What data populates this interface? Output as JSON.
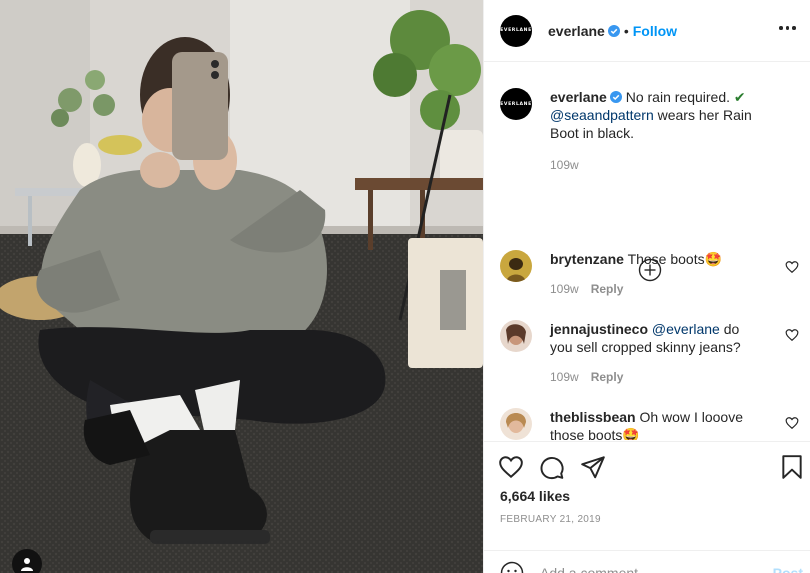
{
  "post": {
    "author": "everlane",
    "avatar_text": "EVERLANE",
    "follow_label": "Follow",
    "dot": "•",
    "caption_text": "No rain required. ",
    "caption_check": "✔",
    "caption_mention": "@seaandpattern",
    "caption_rest": " wears her Rain Boot in black.",
    "caption_time": "109w",
    "likes": "6,664 likes",
    "date": "FEBRUARY 21, 2019"
  },
  "comments": [
    {
      "user": "brytenzane",
      "text": "Those boots",
      "emoji": "🤩",
      "time": "109w",
      "reply": "Reply"
    },
    {
      "user": "jennajustineco",
      "mention": "@everlane",
      "text": " do you sell cropped skinny jeans?",
      "time": "109w",
      "reply": "Reply"
    },
    {
      "user": "theblissbean",
      "text": "Oh wow I looove those boots",
      "emoji": "🤩"
    }
  ],
  "add_comment": {
    "placeholder": "Add a comment...",
    "post_label": "Post"
  },
  "icons": {
    "verified": "verified-badge-icon",
    "more": "more-options-icon",
    "load_more": "plus-circle-icon",
    "heart": "heart-icon",
    "comment": "comment-icon",
    "share": "share-icon",
    "save": "bookmark-icon",
    "emoji": "emoji-icon",
    "user_tag": "user-tag-icon"
  },
  "colors": {
    "accent": "#0095f6",
    "verified": "#3897f0",
    "muted": "#8e8e8e",
    "check": "#2a7d2e"
  }
}
